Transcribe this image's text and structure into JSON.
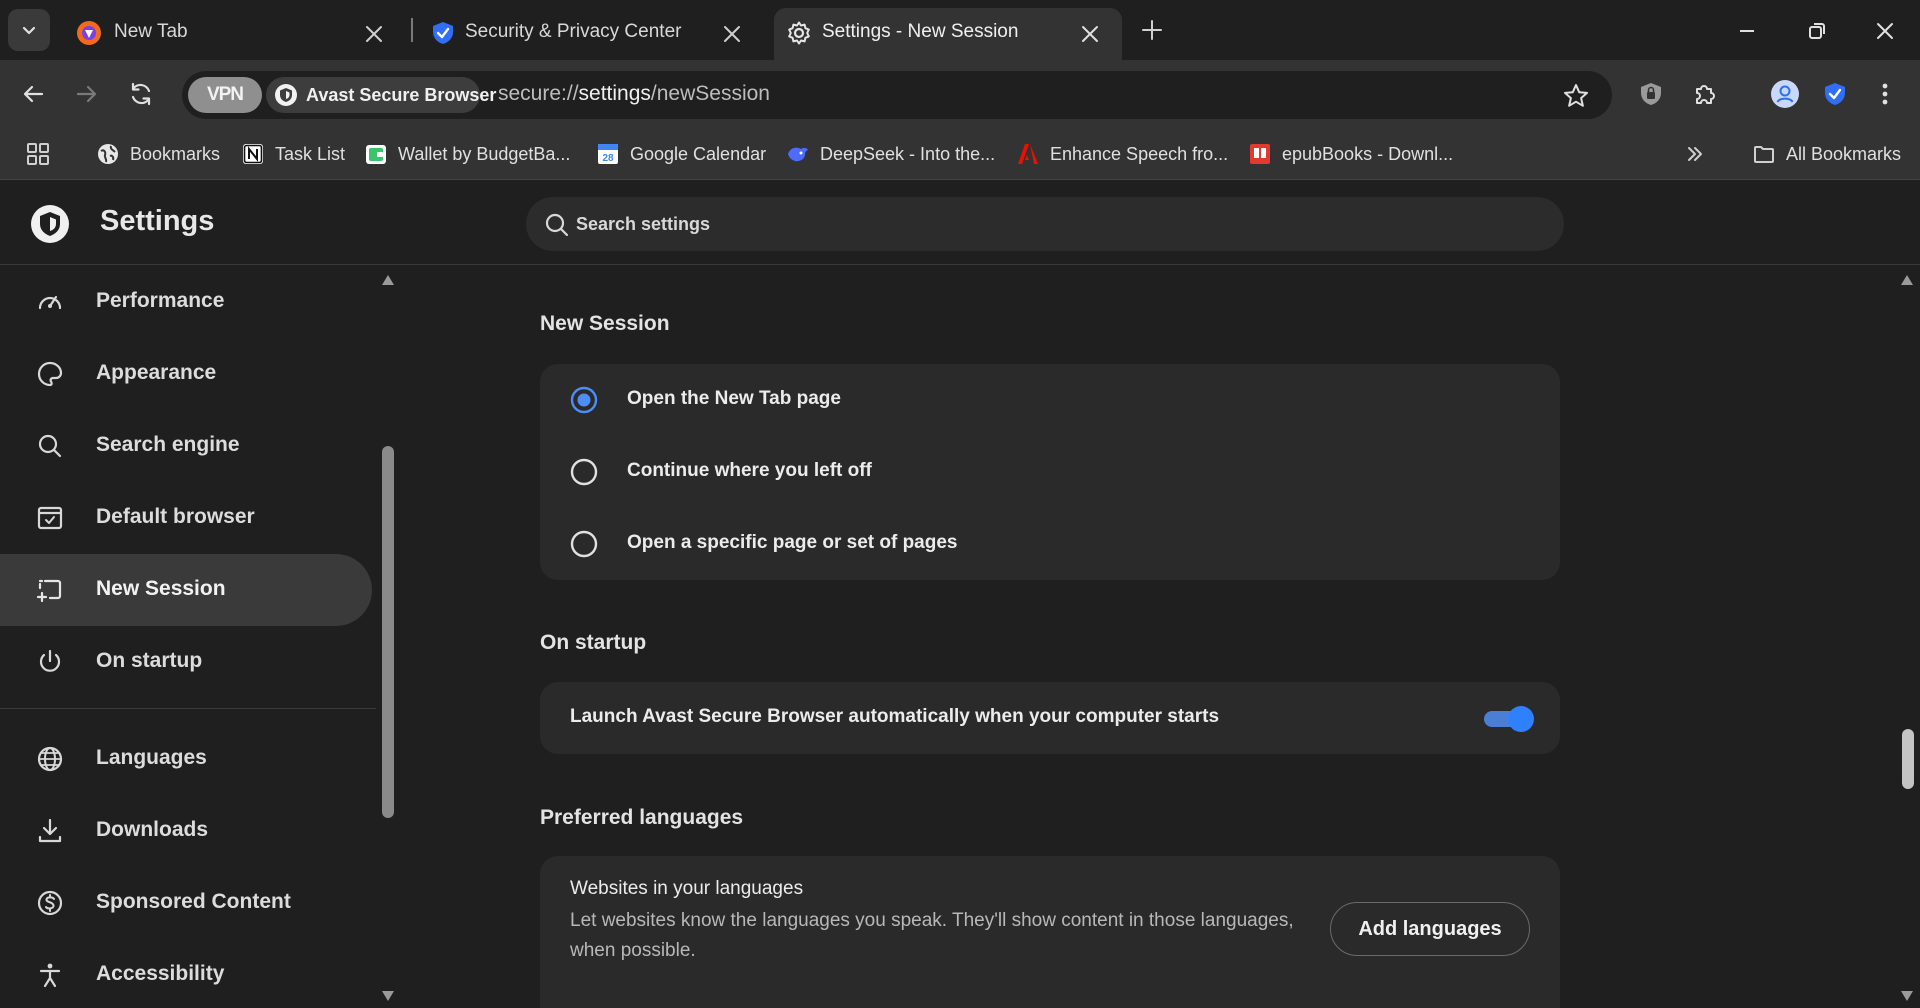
{
  "tabs": [
    {
      "title": "New Tab",
      "icon": "avast-browser-icon"
    },
    {
      "title": "Security & Privacy Center",
      "icon": "shield-check-icon"
    },
    {
      "title": "Settings - New Session",
      "icon": "gear-icon",
      "active": true
    }
  ],
  "toolbar": {
    "vpn_label": "VPN",
    "brand_label": "Avast Secure Browser",
    "url_prefix": "secure://",
    "url_host": "settings",
    "url_path": "/newSession"
  },
  "bookmarks": [
    {
      "label": "Bookmarks",
      "icon": "globe-icon"
    },
    {
      "label": "Task List",
      "icon": "notion-icon"
    },
    {
      "label": "Wallet by BudgetBa...",
      "icon": "wallet-icon"
    },
    {
      "label": "Google Calendar",
      "icon": "calendar-icon"
    },
    {
      "label": "DeepSeek - Into the...",
      "icon": "deepseek-icon"
    },
    {
      "label": "Enhance Speech fro...",
      "icon": "adobe-icon"
    },
    {
      "label": "epubBooks - Downl...",
      "icon": "epub-icon"
    }
  ],
  "all_bookmarks_label": "All Bookmarks",
  "settings": {
    "title": "Settings",
    "search_placeholder": "Search settings"
  },
  "sidebar": {
    "items": [
      {
        "label": "Performance",
        "icon": "speedometer-icon"
      },
      {
        "label": "Appearance",
        "icon": "palette-icon"
      },
      {
        "label": "Search engine",
        "icon": "search-icon"
      },
      {
        "label": "Default browser",
        "icon": "browser-window-icon"
      },
      {
        "label": "New Session",
        "icon": "new-session-icon",
        "selected": true
      },
      {
        "label": "On startup",
        "icon": "power-icon"
      },
      {
        "label": "Languages",
        "icon": "globe-icon"
      },
      {
        "label": "Downloads",
        "icon": "download-icon"
      },
      {
        "label": "Sponsored Content",
        "icon": "dollar-icon"
      },
      {
        "label": "Accessibility",
        "icon": "accessibility-icon"
      }
    ]
  },
  "main": {
    "new_session": {
      "title": "New Session",
      "options": [
        {
          "label": "Open the New Tab page",
          "checked": true
        },
        {
          "label": "Continue where you left off",
          "checked": false
        },
        {
          "label": "Open a specific page or set of pages",
          "checked": false
        }
      ]
    },
    "on_startup": {
      "title": "On startup",
      "toggle_label": "Launch Avast Secure Browser automatically when your computer starts",
      "enabled": true
    },
    "preferred_languages": {
      "title": "Preferred languages",
      "card_title": "Websites in your languages",
      "card_desc": "Let websites know the languages you speak. They'll show content in those languages, when possible.",
      "button_label": "Add languages"
    }
  },
  "colors": {
    "accent": "#2f80ff",
    "background": "#1f1f1f",
    "card": "#2a2a2a",
    "toolbar": "#333333"
  }
}
